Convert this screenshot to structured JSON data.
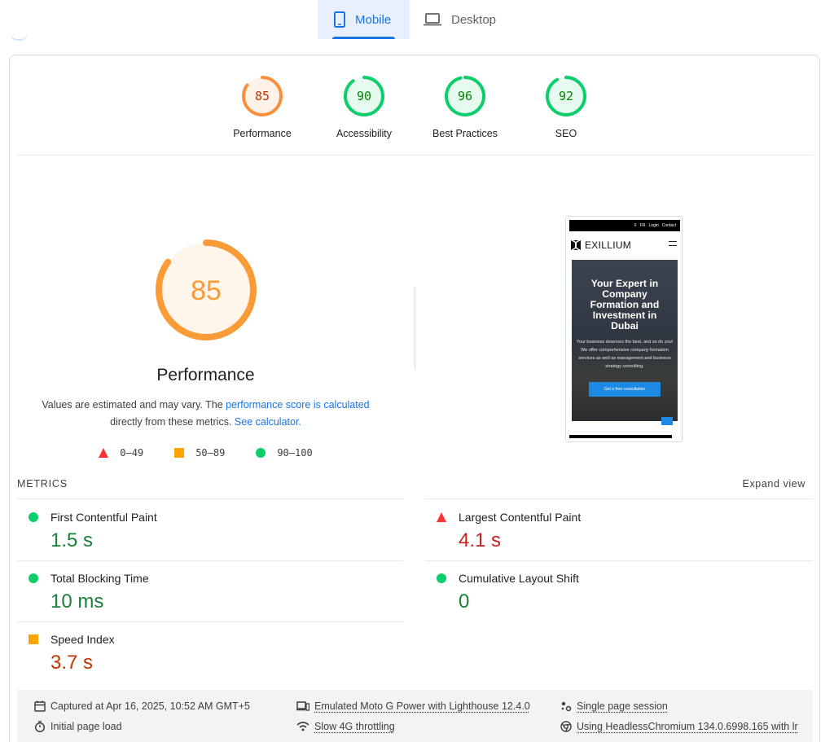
{
  "tabs": {
    "mobile": "Mobile",
    "desktop": "Desktop"
  },
  "categories": [
    {
      "score": "85",
      "label": "Performance",
      "color": "#fa903e"
    },
    {
      "score": "90",
      "label": "Accessibility",
      "color": "#0cce6b"
    },
    {
      "score": "96",
      "label": "Best Practices",
      "color": "#0cce6b"
    },
    {
      "score": "92",
      "label": "SEO",
      "color": "#0cce6b"
    }
  ],
  "performance": {
    "score": "85",
    "title": "Performance",
    "desc_prefix": "Values are estimated and may vary. The ",
    "desc_link1": "performance score is calculated",
    "desc_middle": "directly from these metrics. ",
    "desc_link2": "See calculator.",
    "legend": [
      "0–49",
      "50–89",
      "90–100"
    ]
  },
  "screenshot": {
    "topbar": [
      "FR",
      "Login",
      "Contact"
    ],
    "brand": "EXILLIUM",
    "heading": "Your Expert in Company Formation and Investment in Dubai",
    "body": "Your business deserves the best, and so do you! We offer comprehensive company formation services as well as management and business strategy consulting.",
    "cta": "Get a free consultation"
  },
  "metrics": {
    "header": "METRICS",
    "expand": "Expand view",
    "fcp": {
      "label": "First Contentful Paint",
      "value": "1.5 s"
    },
    "lcp": {
      "label": "Largest Contentful Paint",
      "value": "4.1 s"
    },
    "tbt": {
      "label": "Total Blocking Time",
      "value": "10 ms"
    },
    "cls": {
      "label": "Cumulative Layout Shift",
      "value": "0"
    },
    "si": {
      "label": "Speed Index",
      "value": "3.7 s"
    }
  },
  "footer": {
    "captured": "Captured at Apr 16, 2025, 10:52 AM GMT+5",
    "device": "Emulated Moto G Power with Lighthouse 12.4.0",
    "session": "Single page session",
    "load": "Initial page load",
    "throttling": "Slow 4G throttling",
    "browser": "Using HeadlessChromium 134.0.6998.165 with lr"
  }
}
